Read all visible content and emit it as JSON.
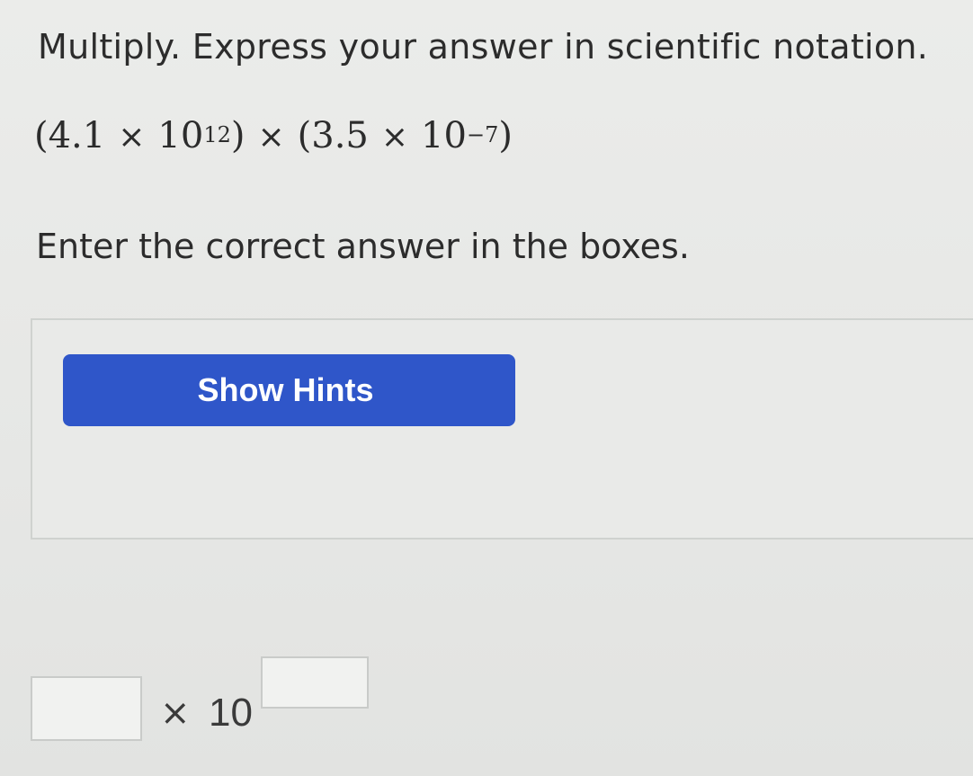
{
  "question": {
    "instruction": "Multiply. Express your answer in scientific notation.",
    "expression": {
      "left_paren": "(",
      "a_coef": "4.1",
      "times1": "×",
      "a_base": "10",
      "a_exp": "12",
      "mid_close": ")",
      "times_mid": "×",
      "mid_open": "(",
      "b_coef": "3.5",
      "times2": "×",
      "b_base": "10",
      "b_exp": "−7",
      "right_paren": ")"
    },
    "prompt": "Enter the correct answer in the boxes."
  },
  "hints": {
    "button_label": "Show Hints",
    "button_color": "#2f56c9"
  },
  "answer": {
    "coefficient_value": "",
    "times": "×",
    "base": "10",
    "exponent_value": ""
  }
}
